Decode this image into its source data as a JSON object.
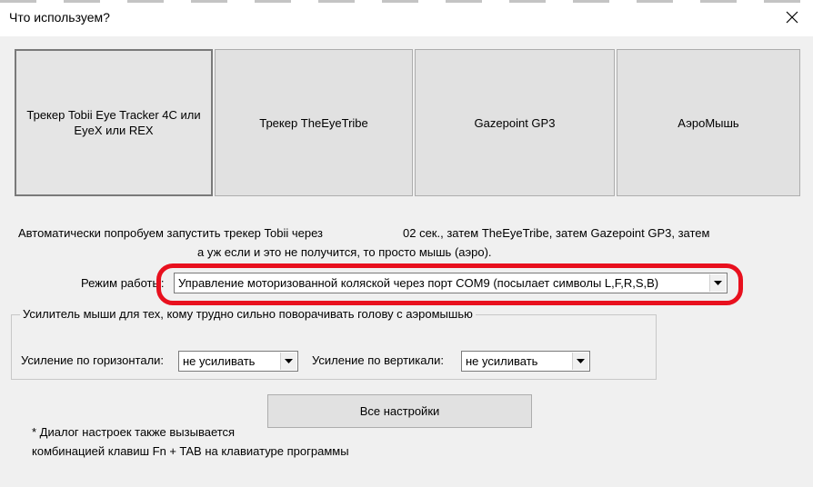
{
  "window": {
    "title": "Что используем?"
  },
  "tracker_buttons": [
    {
      "label": "Трекер Tobii Eye Tracker 4C или EyeX или REX"
    },
    {
      "label": "Трекер TheEyeTribe"
    },
    {
      "label": "Gazepoint GP3"
    },
    {
      "label": "АэроМышь"
    }
  ],
  "auto_start": {
    "line1_prefix": "Автоматически попробуем запустить трекер Tobii через",
    "line1_suffix": "02 сек., затем TheEyeTribe, затем Gazepoint GP3, затем",
    "line2": "а уж если и это не получится, то просто мышь (аэро)."
  },
  "mode": {
    "label": "Режим работы:",
    "selected": "Управление моторизованной коляской через порт COM9 (посылает символы L,F,R,S,B)"
  },
  "amplifier": {
    "group_title": "Усилитель мыши для тех, кому трудно сильно поворачивать голову с аэромышью",
    "horizontal_label": "Усиление по горизонтали:",
    "horizontal_value": "не усиливать",
    "vertical_label": "Усиление по вертикали:",
    "vertical_value": "не усиливать"
  },
  "settings_button": {
    "label": "Все настройки"
  },
  "footnote": {
    "line1": "* Диалог настроек также вызывается",
    "line2": "комбинацией клавиш Fn + TAB на клавиатуре программы"
  },
  "colors": {
    "highlight": "#e8101e",
    "button_face": "#e1e1e1",
    "dialog_bg": "#f0f0f0"
  }
}
